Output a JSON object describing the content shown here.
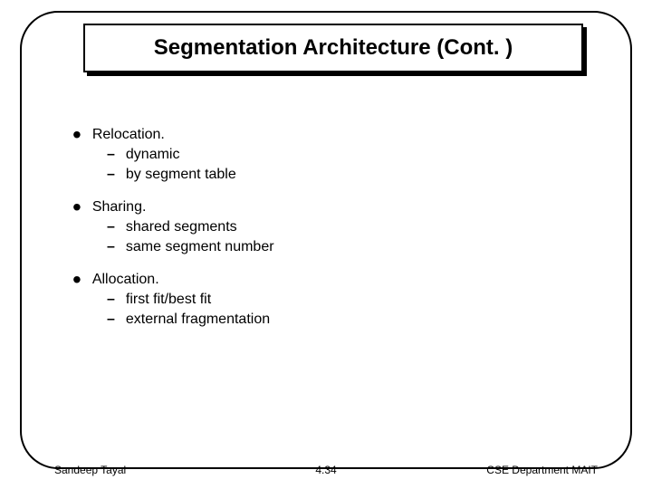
{
  "title": "Segmentation Architecture (Cont. )",
  "bullets": [
    {
      "label": "Relocation.",
      "subs": [
        "dynamic",
        "by segment table"
      ]
    },
    {
      "label": "Sharing.",
      "subs": [
        "shared segments",
        "same segment number"
      ]
    },
    {
      "label": "Allocation.",
      "subs": [
        "first fit/best fit",
        "external fragmentation"
      ]
    }
  ],
  "footer": {
    "left": "Sandeep Tayal",
    "center": "4.34",
    "right": "CSE Department MAIT"
  }
}
